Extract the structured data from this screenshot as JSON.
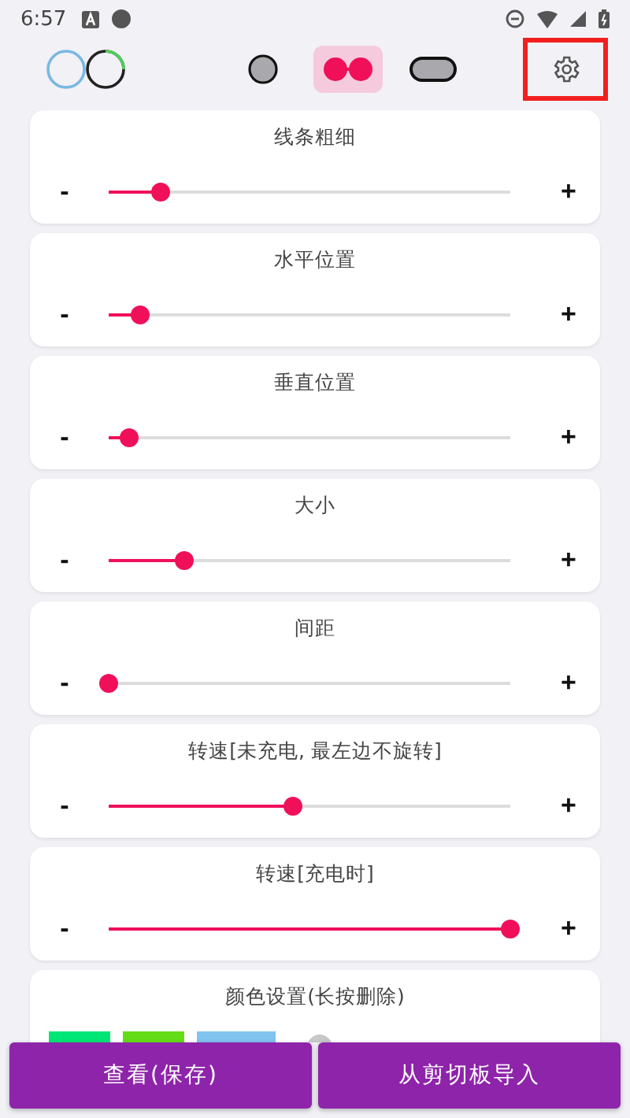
{
  "status_bar": {
    "time": "6:57"
  },
  "styles": [
    {
      "kind": "dot",
      "selected": false
    },
    {
      "kind": "dumbbell",
      "selected": true
    },
    {
      "kind": "pill",
      "selected": false
    }
  ],
  "sliders": [
    {
      "title": "线条粗细",
      "minus": "-",
      "plus": "+",
      "level": 0.13
    },
    {
      "title": "水平位置",
      "minus": "-",
      "plus": "+",
      "level": 0.08
    },
    {
      "title": "垂直位置",
      "minus": "-",
      "plus": "+",
      "level": 0.05
    },
    {
      "title": "大小",
      "minus": "-",
      "plus": "+",
      "level": 0.19
    },
    {
      "title": "间距",
      "minus": "-",
      "plus": "+",
      "level": 0.0
    },
    {
      "title": "转速[未充电, 最左边不旋转]",
      "minus": "-",
      "plus": "+",
      "level": 0.46
    },
    {
      "title": "转速[充电时]",
      "minus": "-",
      "plus": "+",
      "level": 1.0
    }
  ],
  "colors": {
    "title": "颜色设置(长按删除)",
    "swatches": [
      {
        "color": "#00e676"
      },
      {
        "color": "#64dd17"
      },
      {
        "color": "#81c4f0"
      }
    ]
  },
  "buttons": [
    "查看(保存)",
    "从剪切板导入"
  ]
}
